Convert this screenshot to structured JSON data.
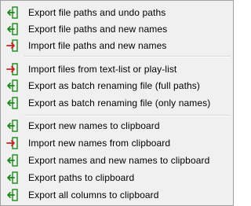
{
  "menu": {
    "items": [
      {
        "label": "Export file paths and undo paths",
        "icon": "export-arrow-icon",
        "color": "#1a8a1a"
      },
      {
        "label": "Export file paths and new names",
        "icon": "export-arrow-icon",
        "color": "#1a8a1a"
      },
      {
        "label": "Import file paths and new names",
        "icon": "import-arrow-icon",
        "color": "#cc1f1f"
      },
      {
        "label": "Import files from text-list or play-list",
        "icon": "import-arrow-icon",
        "color": "#cc1f1f"
      },
      {
        "label": "Export as batch renaming file (full paths)",
        "icon": "export-arrow-icon",
        "color": "#1a8a1a"
      },
      {
        "label": "Export as batch renaming file (only names)",
        "icon": "export-arrow-icon",
        "color": "#1a8a1a"
      },
      {
        "label": "Export new names to clipboard",
        "icon": "export-arrow-icon",
        "color": "#1a8a1a"
      },
      {
        "label": "Import new names from clipboard",
        "icon": "import-arrow-icon",
        "color": "#cc1f1f"
      },
      {
        "label": "Export names and new names to clipboard",
        "icon": "export-arrow-icon",
        "color": "#1a8a1a"
      },
      {
        "label": "Export paths to clipboard",
        "icon": "export-arrow-icon",
        "color": "#1a8a1a"
      },
      {
        "label": "Export all columns to clipboard",
        "icon": "export-arrow-icon",
        "color": "#1a8a1a"
      }
    ]
  }
}
